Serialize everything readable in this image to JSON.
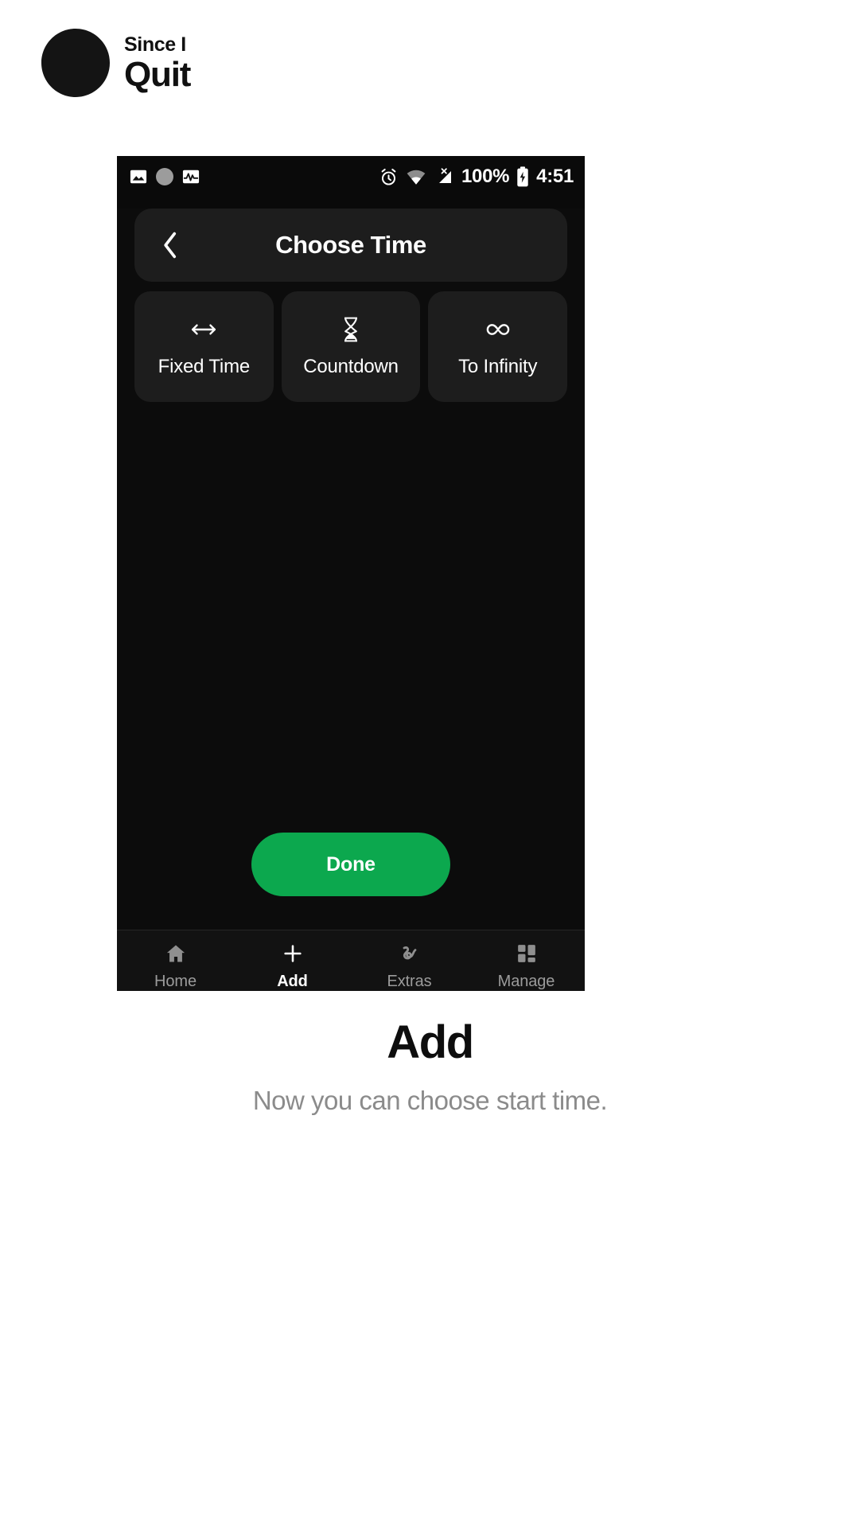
{
  "brand": {
    "logo_icon": "since-i-quit-ring-logo",
    "line1": "Since I",
    "line2": "Quit"
  },
  "phone": {
    "status_bar": {
      "left_icons": [
        {
          "name": "image-icon",
          "label": "image"
        },
        {
          "name": "circle-badge-icon",
          "label": "badge"
        },
        {
          "name": "activity-pulse-icon",
          "label": "activity"
        }
      ],
      "right_icons": [
        {
          "name": "alarm-clock-icon",
          "label": "alarm"
        },
        {
          "name": "wifi-icon",
          "label": "wifi"
        },
        {
          "name": "no-signal-icon",
          "label": "no signal"
        }
      ],
      "battery_percent": "100%",
      "battery_icon": "battery-charging-icon",
      "time": "4:51"
    },
    "appbar": {
      "back_icon": "chevron-left-icon",
      "title": "Choose Time"
    },
    "options": [
      {
        "icon": "left-right-arrow-icon",
        "label": "Fixed Time"
      },
      {
        "icon": "hourglass-icon",
        "label": "Countdown"
      },
      {
        "icon": "infinity-icon",
        "label": "To Infinity"
      }
    ],
    "primary_action": {
      "label": "Done",
      "color": "#0ca84e"
    },
    "bottom_nav": [
      {
        "icon": "home-icon",
        "label": "Home",
        "active": false
      },
      {
        "icon": "plus-icon",
        "label": "Add",
        "active": true
      },
      {
        "icon": "squiggle-icon",
        "label": "Extras",
        "active": false
      },
      {
        "icon": "dashboard-grid-icon",
        "label": "Manage",
        "active": false
      }
    ]
  },
  "caption": {
    "title": "Add",
    "subtitle": "Now you can choose start time."
  },
  "colors": {
    "accent_green": "#0ca84e",
    "phone_bg": "#0c0c0c",
    "card_bg": "#1d1d1d",
    "muted_text": "#8b8b8b"
  }
}
